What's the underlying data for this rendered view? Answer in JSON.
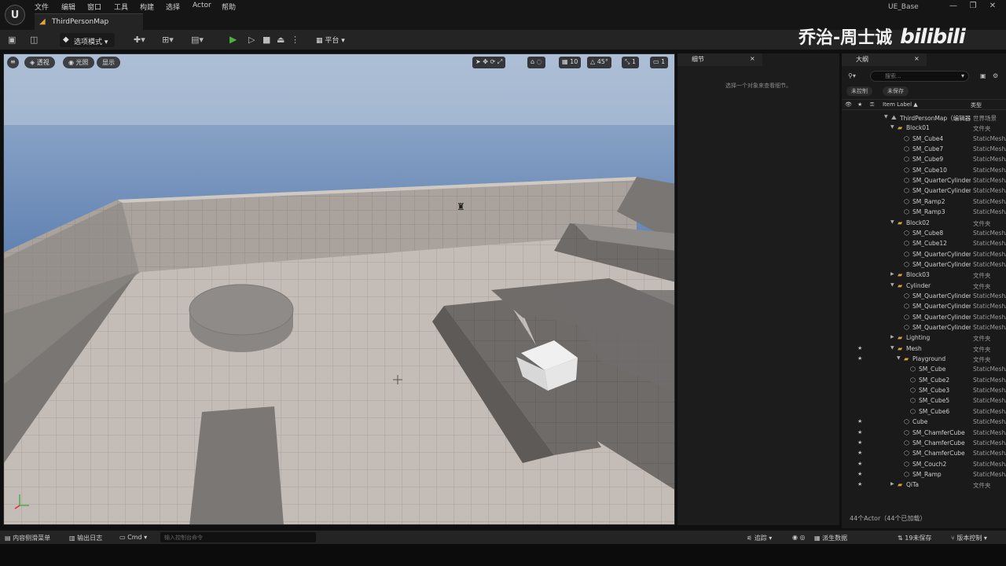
{
  "menubar": {
    "logo": "U",
    "items": [
      "文件",
      "编辑",
      "窗口",
      "工具",
      "构建",
      "选择",
      "Actor",
      "帮助"
    ],
    "project_name": "UE_Base",
    "map_tab": "ThirdPersonMap",
    "window_buttons": [
      "—",
      "❐",
      "✕"
    ]
  },
  "toolbar": {
    "mode_label": "选项模式",
    "platform_label": "平台"
  },
  "watermark": {
    "author": "乔治-周士诚",
    "brand": "bilibili"
  },
  "viewport": {
    "menu_icon": "≡",
    "perspective": "透视",
    "lighting": "光照",
    "show": "显示",
    "grid_snap": "10",
    "rotation_snap": "45°",
    "scale_snap": "1",
    "camera_speed": "1"
  },
  "details": {
    "tab_title": "细节",
    "close": "×",
    "hint": "选择一个对象来查看细节。"
  },
  "outliner": {
    "tab_title": "大纲",
    "close": "×",
    "search_placeholder": "搜索...",
    "chip_uncontrolled": "未控制",
    "chip_unsaved": "未保存",
    "col_label": "Item Label ▲",
    "col_type": "类型",
    "rows": [
      {
        "name": "ThirdPersonMap（编辑器）",
        "type": "世界场景",
        "depth": 0,
        "kind": "map",
        "arrow": "▼",
        "star": false
      },
      {
        "name": "Block01",
        "type": "文件夹",
        "depth": 1,
        "kind": "folder",
        "arrow": "▼",
        "star": false
      },
      {
        "name": "SM_Cube4",
        "type": "StaticMeshActor",
        "depth": 2,
        "kind": "mesh",
        "arrow": "",
        "star": false
      },
      {
        "name": "SM_Cube7",
        "type": "StaticMeshActor",
        "depth": 2,
        "kind": "mesh",
        "arrow": "",
        "star": false
      },
      {
        "name": "SM_Cube9",
        "type": "StaticMeshActor",
        "depth": 2,
        "kind": "mesh",
        "arrow": "",
        "star": false
      },
      {
        "name": "SM_Cube10",
        "type": "StaticMeshActor",
        "depth": 2,
        "kind": "mesh",
        "arrow": "",
        "star": false
      },
      {
        "name": "SM_QuarterCylinder",
        "type": "StaticMeshActor",
        "depth": 2,
        "kind": "mesh",
        "arrow": "",
        "star": false
      },
      {
        "name": "SM_QuarterCylinder",
        "type": "StaticMeshActor",
        "depth": 2,
        "kind": "mesh",
        "arrow": "",
        "star": false
      },
      {
        "name": "SM_Ramp2",
        "type": "StaticMeshActor",
        "depth": 2,
        "kind": "mesh",
        "arrow": "",
        "star": false
      },
      {
        "name": "SM_Ramp3",
        "type": "StaticMeshActor",
        "depth": 2,
        "kind": "mesh",
        "arrow": "",
        "star": false
      },
      {
        "name": "Block02",
        "type": "文件夹",
        "depth": 1,
        "kind": "folder",
        "arrow": "▼",
        "star": false
      },
      {
        "name": "SM_Cube8",
        "type": "StaticMeshActor",
        "depth": 2,
        "kind": "mesh",
        "arrow": "",
        "star": false
      },
      {
        "name": "SM_Cube12",
        "type": "StaticMeshActor",
        "depth": 2,
        "kind": "mesh",
        "arrow": "",
        "star": false
      },
      {
        "name": "SM_QuarterCylinder",
        "type": "StaticMeshActor",
        "depth": 2,
        "kind": "mesh",
        "arrow": "",
        "star": false
      },
      {
        "name": "SM_QuarterCylinder",
        "type": "StaticMeshActor",
        "depth": 2,
        "kind": "mesh",
        "arrow": "",
        "star": false
      },
      {
        "name": "Block03",
        "type": "文件夹",
        "depth": 1,
        "kind": "folder",
        "arrow": "▶",
        "star": false
      },
      {
        "name": "Cylinder",
        "type": "文件夹",
        "depth": 1,
        "kind": "folder",
        "arrow": "▼",
        "star": false
      },
      {
        "name": "SM_QuarterCylinder",
        "type": "StaticMeshActor",
        "depth": 2,
        "kind": "mesh",
        "arrow": "",
        "star": false
      },
      {
        "name": "SM_QuarterCylinder",
        "type": "StaticMeshActor",
        "depth": 2,
        "kind": "mesh",
        "arrow": "",
        "star": false
      },
      {
        "name": "SM_QuarterCylinder",
        "type": "StaticMeshActor",
        "depth": 2,
        "kind": "mesh",
        "arrow": "",
        "star": false
      },
      {
        "name": "SM_QuarterCylinder",
        "type": "StaticMeshActor",
        "depth": 2,
        "kind": "mesh",
        "arrow": "",
        "star": false
      },
      {
        "name": "Lighting",
        "type": "文件夹",
        "depth": 1,
        "kind": "folder",
        "arrow": "▶",
        "star": false
      },
      {
        "name": "Mesh",
        "type": "文件夹",
        "depth": 1,
        "kind": "folder",
        "arrow": "▼",
        "star": true
      },
      {
        "name": "Playground",
        "type": "文件夹",
        "depth": 2,
        "kind": "folder",
        "arrow": "▼",
        "star": true
      },
      {
        "name": "SM_Cube",
        "type": "StaticMeshActor",
        "depth": 3,
        "kind": "mesh",
        "arrow": "",
        "star": false
      },
      {
        "name": "SM_Cube2",
        "type": "StaticMeshActor",
        "depth": 3,
        "kind": "mesh",
        "arrow": "",
        "star": false
      },
      {
        "name": "SM_Cube3",
        "type": "StaticMeshActor",
        "depth": 3,
        "kind": "mesh",
        "arrow": "",
        "star": false
      },
      {
        "name": "SM_Cube5",
        "type": "StaticMeshActor",
        "depth": 3,
        "kind": "mesh",
        "arrow": "",
        "star": false
      },
      {
        "name": "SM_Cube6",
        "type": "StaticMeshActor",
        "depth": 3,
        "kind": "mesh",
        "arrow": "",
        "star": false
      },
      {
        "name": "Cube",
        "type": "StaticMeshActor",
        "depth": 2,
        "kind": "mesh",
        "arrow": "",
        "star": true
      },
      {
        "name": "SM_ChamferCube",
        "type": "StaticMeshActor",
        "depth": 2,
        "kind": "mesh",
        "arrow": "",
        "star": true
      },
      {
        "name": "SM_ChamferCube",
        "type": "StaticMeshActor",
        "depth": 2,
        "kind": "mesh",
        "arrow": "",
        "star": true
      },
      {
        "name": "SM_ChamferCube",
        "type": "StaticMeshActor",
        "depth": 2,
        "kind": "mesh",
        "arrow": "",
        "star": true
      },
      {
        "name": "SM_Couch2",
        "type": "StaticMeshActor",
        "depth": 2,
        "kind": "mesh",
        "arrow": "",
        "star": true
      },
      {
        "name": "SM_Ramp",
        "type": "StaticMeshActor",
        "depth": 2,
        "kind": "mesh",
        "arrow": "",
        "star": true
      },
      {
        "name": "QiTa",
        "type": "文件夹",
        "depth": 1,
        "kind": "folder",
        "arrow": "▶",
        "star": true
      }
    ],
    "footer": "44个Actor（44个已加载）"
  },
  "statusbar": {
    "content_drawer": "内容侧滑菜单",
    "output_log": "输出日志",
    "cmd": "Cmd",
    "cmd_placeholder": "输入控制台命令",
    "trace": "追踪",
    "derived_data": "派生数据",
    "unsaved": "19未保存",
    "source_control": "版本控制"
  }
}
